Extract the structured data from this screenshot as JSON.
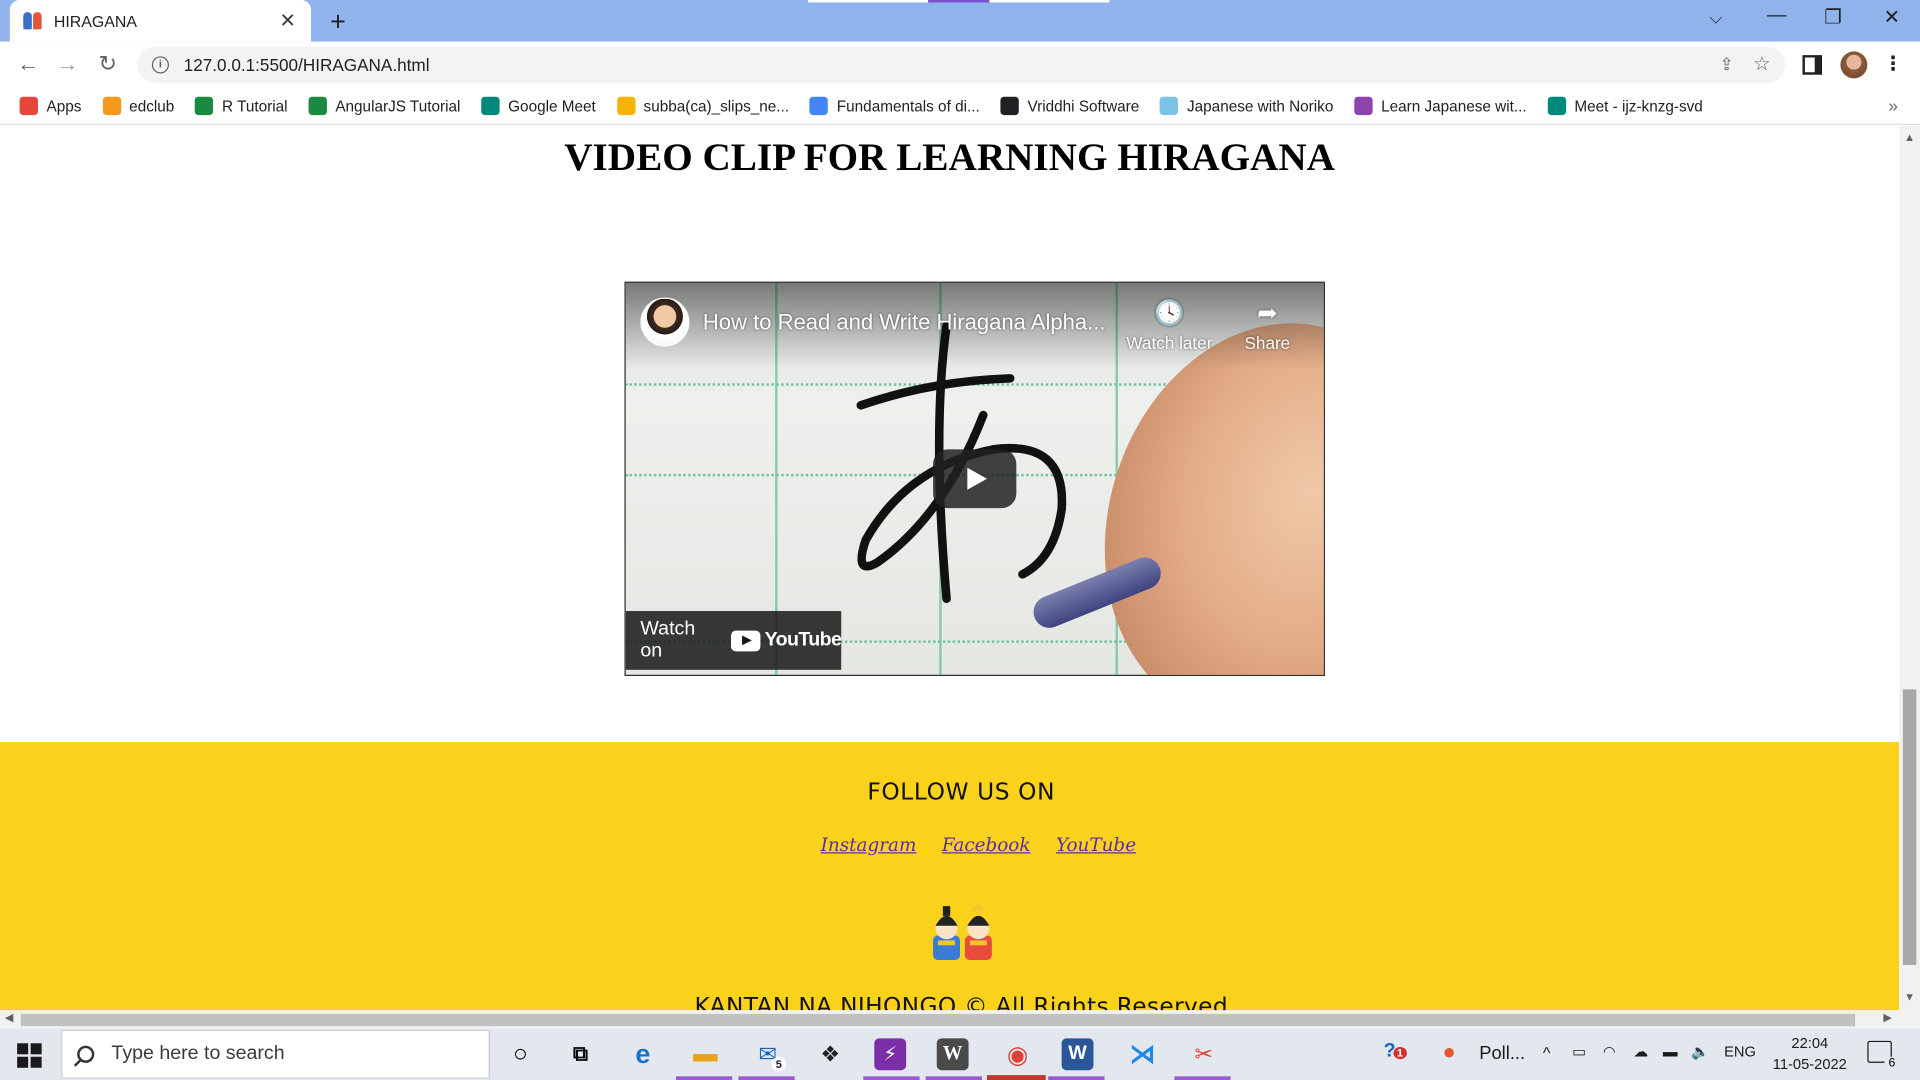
{
  "browser": {
    "tab_title": "HIRAGANA",
    "tab_close": "✕",
    "new_tab": "+",
    "tab_dropdown": "⌵",
    "minimize": "—",
    "restore": "❐",
    "close": "✕",
    "back": "←",
    "forward": "→",
    "reload": "↻",
    "url": "127.0.0.1:5500/HIRAGANA.html",
    "more_bookmarks": "»",
    "menu": "⋮"
  },
  "bookmarks": [
    {
      "label": "Apps",
      "icon": "apps-grid-icon",
      "color": "#e8453c"
    },
    {
      "label": "edclub",
      "icon": "edclub-icon",
      "color": "#f39a1e"
    },
    {
      "label": "R Tutorial",
      "icon": "w3schools-icon",
      "color": "#1a8a43"
    },
    {
      "label": "AngularJS Tutorial",
      "icon": "w3schools-icon",
      "color": "#1a8a43"
    },
    {
      "label": "Google Meet",
      "icon": "meet-icon",
      "color": "#00897b"
    },
    {
      "label": "subba(ca)_slips_ne...",
      "icon": "drive-icon",
      "color": "#f4b400"
    },
    {
      "label": "Fundamentals of di...",
      "icon": "google-icon",
      "color": "#4285f4"
    },
    {
      "label": "Vriddhi Software",
      "icon": "globe-icon",
      "color": "#202124"
    },
    {
      "label": "Japanese with Noriko",
      "icon": "page-icon",
      "color": "#7cc3e8"
    },
    {
      "label": "Learn Japanese wit...",
      "icon": "podcast-icon",
      "color": "#8e44ad"
    },
    {
      "label": "Meet - ijz-knzg-svd",
      "icon": "meet-icon",
      "color": "#00897b"
    }
  ],
  "page": {
    "heading": "VIDEO CLIP FOR LEARNING HIRAGANA",
    "video": {
      "title": "How to Read and Write Hiragana Alpha...",
      "watch_later": "Watch later",
      "share": "Share",
      "watch_on": "Watch on",
      "youtube": "YouTube"
    },
    "footer": {
      "follow": "FOLLOW US ON",
      "links": [
        "Instagram",
        "Facebook",
        "YouTube"
      ],
      "copyright": "KANTAN NA NIHONGO © All Rights Reserved"
    }
  },
  "taskbar": {
    "search_placeholder": "Type here to search",
    "mail_badge": "5",
    "help_badge": "1",
    "app_label": "Poll...",
    "language": "ENG",
    "time": "22:04",
    "date": "11-05-2022",
    "notifications": "6"
  }
}
